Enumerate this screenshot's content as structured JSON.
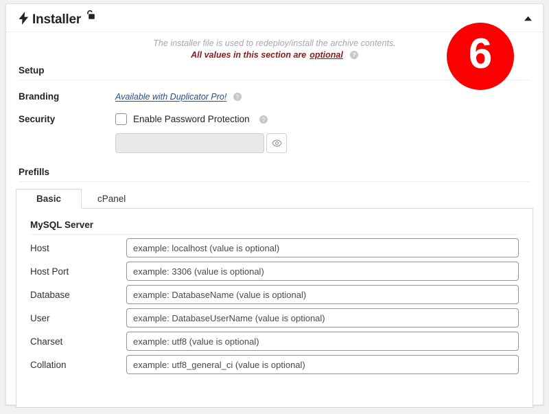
{
  "header": {
    "title": "Installer",
    "bolt_icon": "lightning-bolt-icon",
    "lock_icon": "open-padlock-icon",
    "collapse_icon": "chevron-up-icon"
  },
  "intro": {
    "line1": "The installer file is used to redeploy/install the archive contents.",
    "line2_prefix": "All values in this section are",
    "line2_emphasis": "optional",
    "help_icon": "help-icon"
  },
  "setup": {
    "heading": "Setup",
    "branding": {
      "label": "Branding",
      "link_text": "Available with Duplicator Pro!",
      "help_icon": "help-icon"
    },
    "security": {
      "label": "Security",
      "checkbox_label": "Enable Password Protection",
      "checkbox_checked": false,
      "help_icon": "help-icon",
      "password_value": "",
      "password_placeholder": "",
      "eye_icon": "eye-icon"
    }
  },
  "prefills": {
    "heading": "Prefills",
    "tabs": [
      {
        "label": "Basic",
        "active": true
      },
      {
        "label": "cPanel",
        "active": false
      }
    ],
    "panel": {
      "heading": "MySQL Server",
      "fields": [
        {
          "label": "Host",
          "value": "",
          "placeholder": "example: localhost (value is optional)"
        },
        {
          "label": "Host Port",
          "value": "",
          "placeholder": "example: 3306 (value is optional)"
        },
        {
          "label": "Database",
          "value": "",
          "placeholder": "example: DatabaseName (value is optional)"
        },
        {
          "label": "User",
          "value": "",
          "placeholder": "example: DatabaseUserName (value is optional)"
        },
        {
          "label": "Charset",
          "value": "",
          "placeholder": "example: utf8 (value is optional)"
        },
        {
          "label": "Collation",
          "value": "",
          "placeholder": "example: utf8_general_ci (value is optional)"
        }
      ]
    }
  },
  "step_badge": {
    "number": "6",
    "color": "#fa0000"
  }
}
